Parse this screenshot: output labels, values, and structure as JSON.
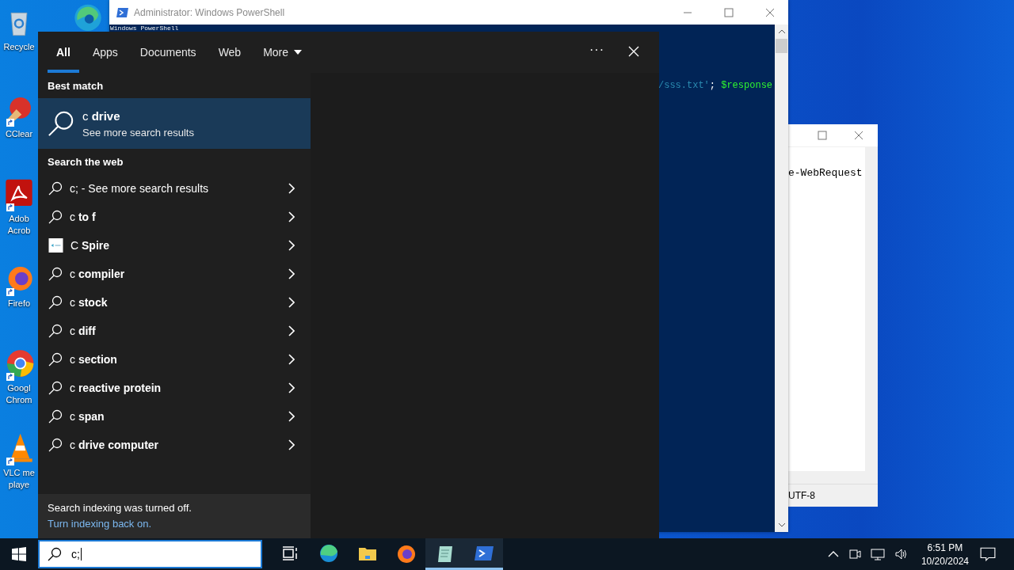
{
  "desktop_icons": [
    {
      "kind": "recycle-bin",
      "lines": [
        "Recycle"
      ],
      "shortcut": false
    },
    {
      "kind": "cleaner",
      "lines": [
        "CClear"
      ],
      "shortcut": true
    },
    {
      "kind": "pdf",
      "lines": [
        "Adob",
        "Acrob"
      ],
      "shortcut": true
    },
    {
      "kind": "fox",
      "lines": [
        "Firefo"
      ],
      "shortcut": true
    },
    {
      "kind": "chrome",
      "lines": [
        "Googl",
        "Chrom"
      ],
      "shortcut": true
    },
    {
      "kind": "cone",
      "lines": [
        "VLC me",
        "playe"
      ],
      "shortcut": true
    }
  ],
  "powershell_window": {
    "title": "Administrator: Windows PowerShell",
    "banner": "Windows PowerShell",
    "code": [
      {
        "kind": "string",
        "text": "/sss.txt'"
      },
      {
        "kind": "operator",
        "text": "; "
      },
      {
        "kind": "variable",
        "text": "$response"
      }
    ]
  },
  "editor_window": {
    "line": "e-WebRequest",
    "encoding": "UTF-8"
  },
  "search": {
    "tabs": [
      {
        "label": "All",
        "selected": true,
        "dropdown": false
      },
      {
        "label": "Apps",
        "selected": false,
        "dropdown": false
      },
      {
        "label": "Documents",
        "selected": false,
        "dropdown": false
      },
      {
        "label": "Web",
        "selected": false,
        "dropdown": false
      },
      {
        "label": "More",
        "selected": false,
        "dropdown": true
      }
    ],
    "options": "···",
    "best_match": {
      "heading": "Best match",
      "title": "c **drive**",
      "subtitle": "See more search results",
      "selected": true
    },
    "web_heading": "Search the web",
    "results": [
      {
        "kind": "search",
        "text": "c; - See more search results"
      },
      {
        "kind": "search",
        "text": "c **to f**"
      },
      {
        "kind": "site",
        "text": "C **Spire**"
      },
      {
        "kind": "search",
        "text": "c **compiler**"
      },
      {
        "kind": "search",
        "text": "c **stock**"
      },
      {
        "kind": "search",
        "text": "c **diff**"
      },
      {
        "kind": "search",
        "text": "c **section**"
      },
      {
        "kind": "search",
        "text": "c **reactive protein**"
      },
      {
        "kind": "search",
        "text": "c **span**"
      },
      {
        "kind": "search",
        "text": "c **drive computer**"
      }
    ],
    "notice": "Search indexing was turned off.",
    "notice_link": "Turn indexing back on."
  },
  "taskbar": {
    "search_value": "c;",
    "apps": [
      {
        "kind": "task-view",
        "active": false
      },
      {
        "kind": "edge",
        "active": false
      },
      {
        "kind": "folder",
        "active": false
      },
      {
        "kind": "fox",
        "active": false
      },
      {
        "kind": "notepad",
        "active": true
      },
      {
        "kind": "terminal",
        "active": true
      }
    ],
    "time": "6:51 PM",
    "date": "10/20/2024"
  }
}
